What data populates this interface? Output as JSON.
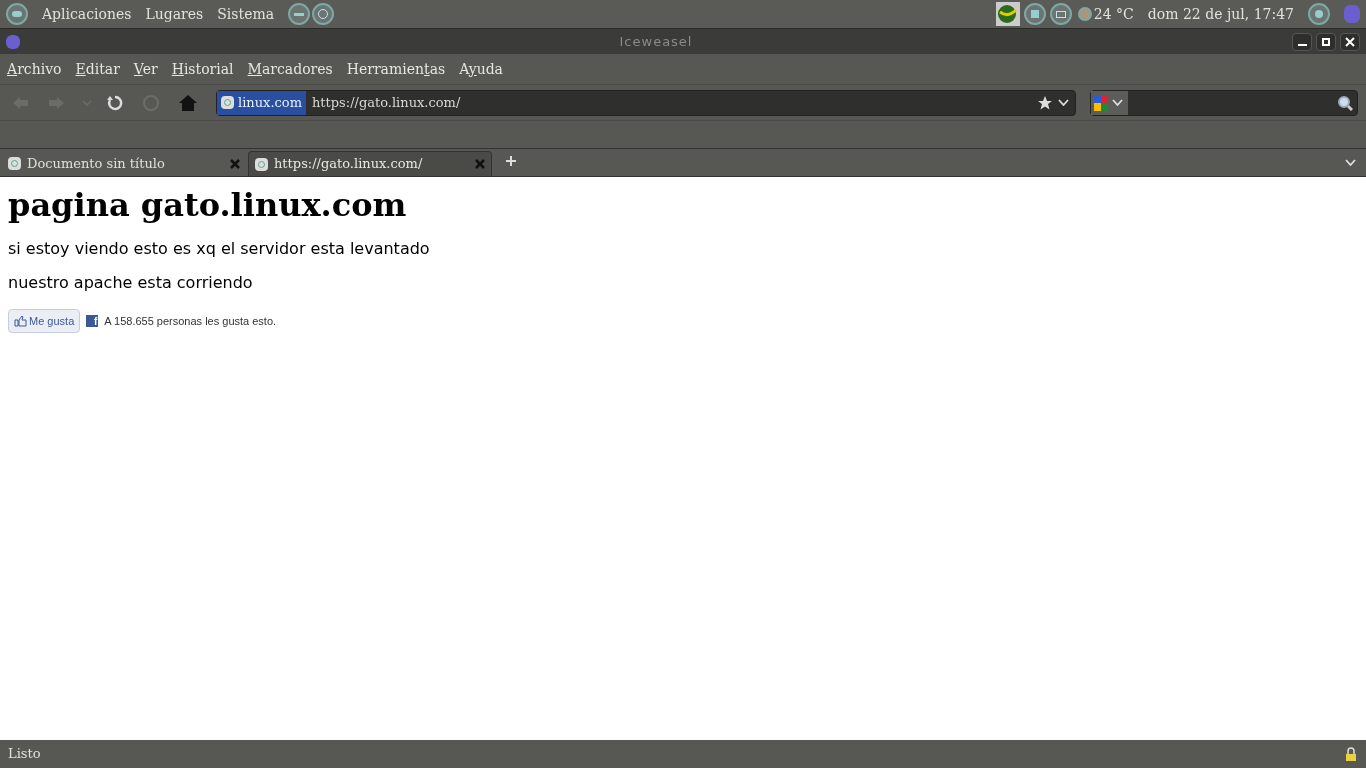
{
  "panel": {
    "menus": [
      "Aplicaciones",
      "Lugares",
      "Sistema"
    ],
    "temperature": "24 °C",
    "clock": "dom 22 de jul, 17:47"
  },
  "window": {
    "title": "Iceweasel"
  },
  "menu_bar": [
    {
      "key": "A",
      "after": "rchivo"
    },
    {
      "key": "E",
      "after": "ditar"
    },
    {
      "key": "V",
      "after": "er"
    },
    {
      "key": "H",
      "after": "istorial"
    },
    {
      "key": "M",
      "after": "arcadores"
    },
    {
      "before": "Herramien",
      "key": "t",
      "after": "as"
    },
    {
      "before": "A",
      "key": "y",
      "after": "uda"
    }
  ],
  "toolbar": {
    "back_disabled": true,
    "forward_disabled": true,
    "stop_disabled": true,
    "site_identity": "linux.com",
    "url": "https://gato.linux.com/"
  },
  "tabs": [
    {
      "label": "Documento sin título",
      "selected": false
    },
    {
      "label": "https://gato.linux.com/",
      "selected": true
    }
  ],
  "page": {
    "heading": "pagina gato.linux.com",
    "paragraphs": [
      "si estoy viendo esto es xq el servidor esta levantado",
      "nuestro apache esta corriendo"
    ],
    "like_button": "Me gusta",
    "facebook_icon": "f",
    "like_count": "A 158.655 personas les gusta esto."
  },
  "status_bar": {
    "text": "Listo"
  }
}
